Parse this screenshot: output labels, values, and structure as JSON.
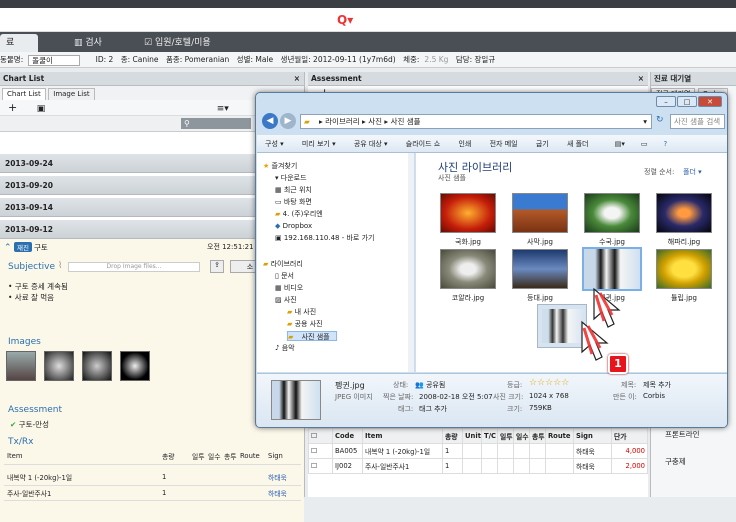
{
  "app": {
    "tabs": [
      {
        "label": "료"
      },
      {
        "label": "검사"
      },
      {
        "label": "입원/호텔/미용"
      }
    ]
  },
  "patient": {
    "owner_label": "동물명:",
    "owner_value": "돌쿨이",
    "id": "ID: 2",
    "species": "종: Canine",
    "breed": "품종: Pomeranian",
    "sex": "성별: Male",
    "birth": "생년월일: 2012-09-11 (1y7m6d)",
    "weight_label": "체중:",
    "weight_value": "2.5 Kg",
    "doctor": "담당: 장일규"
  },
  "chart_list": {
    "title": "Chart List",
    "tabs": [
      "Chart List",
      "Image List"
    ],
    "dates": [
      "2013-09-24",
      "2013-09-20",
      "2013-09-14",
      "2013-09-12"
    ],
    "entry": {
      "badge": "재진",
      "title": "구토",
      "time": "오전 12:51:21",
      "subjective_label": "Subjective",
      "drop_placeholder": "Drop Image files...",
      "sign_button": "소",
      "notes": [
        "• 구토 증세 계속됨",
        "• 사료 잘 먹음"
      ],
      "images_label": "Images",
      "assessment_label": "Assessment",
      "assessment_item": "구토-만성",
      "txrx_label": "Tx/Rx",
      "tx_headers": [
        "Item",
        "총량",
        "일투",
        "일수",
        "총투",
        "Route",
        "Sign"
      ],
      "tx_rows": [
        {
          "item": "내복약 1 (-20kg)-1일",
          "total": "1",
          "sign": "하태욱"
        },
        {
          "item": "주사-일반주사1",
          "total": "1",
          "sign": "하태욱"
        }
      ]
    }
  },
  "assessment_panel": {
    "title": "Assessment",
    "order_headers": [
      "Code",
      "Item",
      "총량",
      "Unit",
      "T/C",
      "일투",
      "일수",
      "총투",
      "Route",
      "Sign",
      "단가"
    ],
    "order_rows": [
      {
        "code": "BA005",
        "item": "내복약 1 (-20kg)-1일",
        "total": "1",
        "sign": "하태욱",
        "price": "4,000"
      },
      {
        "code": "IJ002",
        "item": "주사-일반주사1",
        "total": "1",
        "sign": "하태욱",
        "price": "2,000"
      }
    ]
  },
  "waiting": {
    "title": "진료 대기열",
    "tabs": [
      "진료 대기열",
      "Order"
    ],
    "items": [
      "프론트라인",
      "구충제"
    ]
  },
  "explorer": {
    "breadcrumb": [
      "라이브러리",
      "사진",
      "사진 샘플"
    ],
    "search_placeholder": "사진 샘플 검색",
    "toolbar": [
      "구성 ▾",
      "미리 보기 ▾",
      "공유 대상 ▾",
      "슬라이드 쇼",
      "인쇄",
      "전자 메일",
      "굽기",
      "새 폴더"
    ],
    "nav": {
      "favorites": "즐겨찾기",
      "fav_items": [
        "다운로드",
        "최근 위치",
        "바탕 화면",
        "4. (주)우리엔",
        "Dropbox",
        "192.168.110.48 - 바로 가기"
      ],
      "libraries": "라이브러리",
      "lib_items": [
        "문서",
        "비디오",
        "사진",
        "내 사진",
        "공용 사진",
        "사진 샘플",
        "음악"
      ]
    },
    "library_title": "사진 라이브러리",
    "library_sub": "사진 샘플",
    "sort_label": "정렬 순서:",
    "sort_value": "폴더 ▾",
    "photos": [
      "국화.jpg",
      "사막.jpg",
      "수국.jpg",
      "해파리.jpg",
      "코알라.jpg",
      "등대.jpg",
      "펭귄.jpg",
      "튤립.jpg"
    ],
    "details": {
      "name": "펭귄.jpg",
      "type": "JPEG 이미지",
      "state_label": "상태:",
      "state_value": "공유됨",
      "date_label": "찍은 날짜:",
      "date_value": "2008-02-18 오전 5:07",
      "tags_label": "태그:",
      "tags_value": "태그 추가",
      "rating_label": "등급:",
      "size_label": "사진 크기:",
      "size_value": "1024 x 768",
      "bytes_label": "크기:",
      "bytes_value": "759KB",
      "title_label": "제목:",
      "title_value": "제목 추가",
      "author_label": "만든 이:",
      "author_value": "Corbis"
    }
  },
  "annotation": {
    "step": "1"
  },
  "colors": {
    "accent": "#2a6fb0",
    "badge": "#e8141c",
    "price": "#d00000"
  }
}
